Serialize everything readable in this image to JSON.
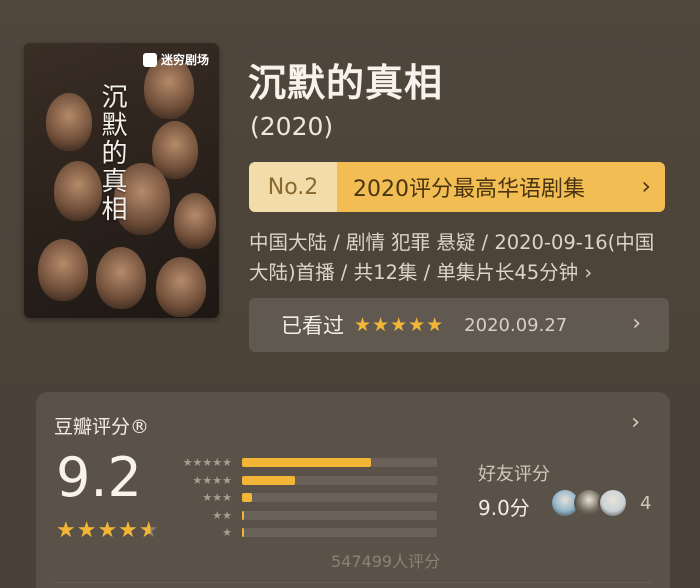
{
  "poster": {
    "brand": "迷穷剧场",
    "title_art": "沉默的真相"
  },
  "title": "沉默的真相",
  "year": "(2020)",
  "ranking": {
    "no": "No.2",
    "text": "2020评分最高华语剧集",
    "chevron": "›"
  },
  "meta": {
    "text": "中国大陆 / 剧情 犯罪 悬疑 / 2020-09-16(中国大陆)首播 / 共12集 / 单集片长45分钟",
    "chevron": "›"
  },
  "watched": {
    "label": "已看过",
    "stars": "★★★★★",
    "date": "2020.09.27",
    "chevron": "›"
  },
  "rating": {
    "title": "豆瓣评分®",
    "chevron": "›",
    "score": "9.2",
    "stars_full": "★★★★",
    "stars_half": "★",
    "distribution": [
      {
        "stars": "★★★★★",
        "fraction": 0.66
      },
      {
        "stars": "★★★★",
        "fraction": 0.27
      },
      {
        "stars": "★★★",
        "fraction": 0.05
      },
      {
        "stars": "★★",
        "fraction": 0.008
      },
      {
        "stars": "★",
        "fraction": 0.004
      }
    ],
    "count": "547499人评分"
  },
  "friends": {
    "title": "好友评分",
    "score": "9.0分",
    "count": "4",
    "avatar_colors": [
      "#8fb3c9",
      "#6f6a5d",
      "#c9d2d8"
    ]
  },
  "colors": {
    "accent": "#f2b536",
    "banner_dark": "#f2be53",
    "banner_light": "#f1dcaa"
  }
}
